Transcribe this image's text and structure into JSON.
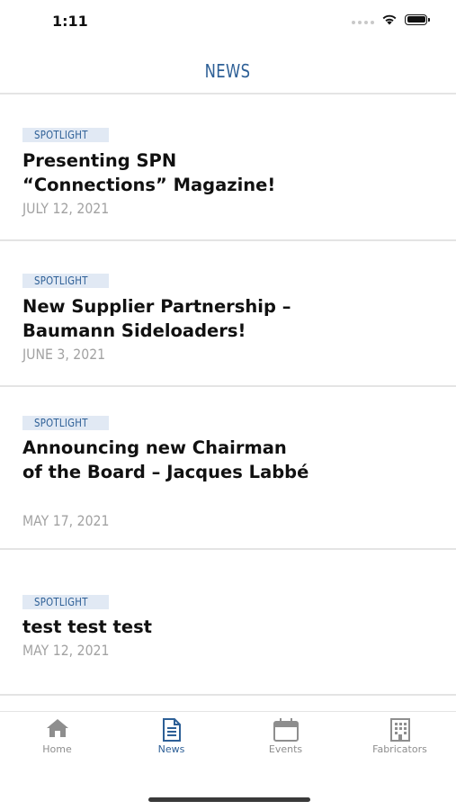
{
  "status": {
    "time": "1:11"
  },
  "header": {
    "title": "NEWS"
  },
  "news": [
    {
      "category": "SPOTLIGHT",
      "title": "Presenting SPN “Connections” Magazine!",
      "date": "JULY 12, 2021"
    },
    {
      "category": "SPOTLIGHT",
      "title": "New Supplier Partnership – Baumann Sideloaders!",
      "date": "JUNE 3, 2021"
    },
    {
      "category": "SPOTLIGHT",
      "title": "Announcing new Chairman of the Board – Jacques Labbé",
      "date": "MAY 17, 2021"
    },
    {
      "category": "SPOTLIGHT",
      "title": "test test test",
      "date": "MAY 12, 2021"
    }
  ],
  "tabs": [
    {
      "label": "Home",
      "icon": "home-icon"
    },
    {
      "label": "News",
      "icon": "newspaper-icon"
    },
    {
      "label": "Events",
      "icon": "calendar-icon"
    },
    {
      "label": "Fabricators",
      "icon": "building-icon"
    }
  ],
  "colors": {
    "accent": "#2d5f96",
    "badge_bg": "#e1e9f4",
    "date": "#a2a2a2",
    "tab_inactive": "#8e8e8e"
  }
}
